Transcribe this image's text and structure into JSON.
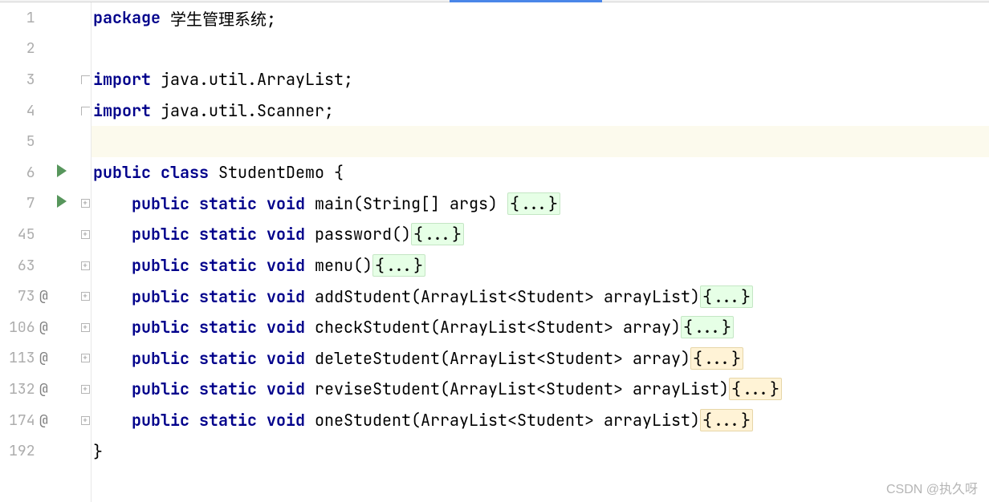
{
  "gutter": {
    "lines": [
      {
        "n": "1",
        "anno": "",
        "run": false,
        "fold": ""
      },
      {
        "n": "2",
        "anno": "",
        "run": false,
        "fold": ""
      },
      {
        "n": "3",
        "anno": "",
        "run": false,
        "fold": "minus"
      },
      {
        "n": "4",
        "anno": "",
        "run": false,
        "fold": "minus"
      },
      {
        "n": "5",
        "anno": "",
        "run": false,
        "fold": ""
      },
      {
        "n": "6",
        "anno": "",
        "run": true,
        "fold": ""
      },
      {
        "n": "7",
        "anno": "",
        "run": true,
        "fold": "plus"
      },
      {
        "n": "45",
        "anno": "",
        "run": false,
        "fold": "plus"
      },
      {
        "n": "63",
        "anno": "",
        "run": false,
        "fold": "plus"
      },
      {
        "n": "73",
        "anno": "@",
        "run": false,
        "fold": "plus"
      },
      {
        "n": "106",
        "anno": "@",
        "run": false,
        "fold": "plus"
      },
      {
        "n": "113",
        "anno": "@",
        "run": false,
        "fold": "plus"
      },
      {
        "n": "132",
        "anno": "@",
        "run": false,
        "fold": "plus"
      },
      {
        "n": "174",
        "anno": "@",
        "run": false,
        "fold": "plus"
      },
      {
        "n": "192",
        "anno": "",
        "run": false,
        "fold": ""
      }
    ]
  },
  "code": {
    "rows": [
      {
        "hl": false,
        "indent": 0,
        "segs": [
          {
            "t": "package ",
            "c": "kw"
          },
          {
            "t": "学生管理系统;",
            "c": "plain"
          }
        ]
      },
      {
        "hl": false,
        "indent": 0,
        "segs": []
      },
      {
        "hl": false,
        "indent": 0,
        "segs": [
          {
            "t": "import ",
            "c": "kw"
          },
          {
            "t": "java.util.ArrayList;",
            "c": "plain"
          }
        ]
      },
      {
        "hl": false,
        "indent": 0,
        "segs": [
          {
            "t": "import ",
            "c": "kw"
          },
          {
            "t": "java.util.Scanner;",
            "c": "plain"
          }
        ]
      },
      {
        "hl": true,
        "indent": 0,
        "segs": []
      },
      {
        "hl": false,
        "indent": 0,
        "segs": [
          {
            "t": "public class ",
            "c": "kw"
          },
          {
            "t": "StudentDemo {",
            "c": "plain"
          }
        ]
      },
      {
        "hl": false,
        "indent": 1,
        "segs": [
          {
            "t": "public static void ",
            "c": "kw"
          },
          {
            "t": "main(String[] args) ",
            "c": "plain"
          },
          {
            "t": "{...}",
            "c": "fold"
          }
        ]
      },
      {
        "hl": false,
        "indent": 1,
        "segs": [
          {
            "t": "public static void ",
            "c": "kw"
          },
          {
            "t": "password()",
            "c": "plain"
          },
          {
            "t": "{...}",
            "c": "fold"
          }
        ]
      },
      {
        "hl": false,
        "indent": 1,
        "segs": [
          {
            "t": "public static void ",
            "c": "kw"
          },
          {
            "t": "menu()",
            "c": "plain"
          },
          {
            "t": "{...}",
            "c": "fold"
          }
        ]
      },
      {
        "hl": false,
        "indent": 1,
        "segs": [
          {
            "t": "public static void ",
            "c": "kw"
          },
          {
            "t": "addStudent(ArrayList<Student> arrayList)",
            "c": "plain"
          },
          {
            "t": "{...}",
            "c": "fold"
          }
        ]
      },
      {
        "hl": false,
        "indent": 1,
        "segs": [
          {
            "t": "public static void ",
            "c": "kw"
          },
          {
            "t": "checkStudent(ArrayList<Student> array)",
            "c": "plain"
          },
          {
            "t": "{...}",
            "c": "fold"
          }
        ]
      },
      {
        "hl": false,
        "indent": 1,
        "segs": [
          {
            "t": "public static void ",
            "c": "kw"
          },
          {
            "t": "deleteStudent(ArrayList<Student> array)",
            "c": "plain"
          },
          {
            "t": "{...}",
            "c": "fold-mod"
          }
        ]
      },
      {
        "hl": false,
        "indent": 1,
        "segs": [
          {
            "t": "public static void ",
            "c": "kw"
          },
          {
            "t": "reviseStudent(ArrayList<Student> arrayList)",
            "c": "plain"
          },
          {
            "t": "{...}",
            "c": "fold-mod"
          }
        ]
      },
      {
        "hl": false,
        "indent": 1,
        "segs": [
          {
            "t": "public static void ",
            "c": "kw"
          },
          {
            "t": "oneStudent(ArrayList<Student> arrayList)",
            "c": "plain"
          },
          {
            "t": "{...}",
            "c": "fold-mod"
          }
        ]
      },
      {
        "hl": false,
        "indent": 0,
        "segs": [
          {
            "t": "}",
            "c": "plain"
          }
        ]
      }
    ]
  },
  "fold_placeholder": "{...}",
  "watermark": "CSDN @执久呀"
}
